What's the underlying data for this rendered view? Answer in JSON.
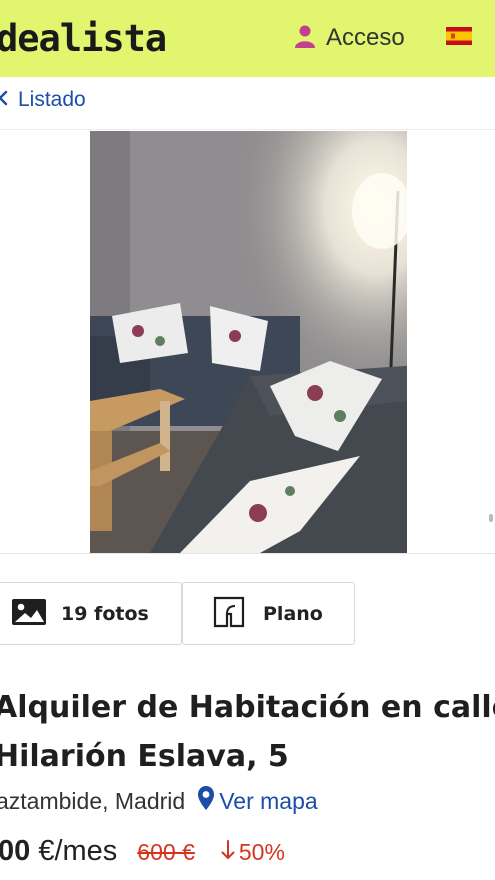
{
  "header": {
    "logo": "dealista",
    "access_label": "Acceso",
    "icons": {
      "user": "user-icon",
      "flag": "spain-flag-icon"
    },
    "colors": {
      "background": "#e1f56e",
      "user_icon": "#c2418f"
    }
  },
  "nav": {
    "back_label": "Listado",
    "icons": {
      "back": "chevron-left-icon"
    }
  },
  "gallery": {
    "photos_label": "19 fotos",
    "plan_label": "Plano",
    "icons": {
      "photos": "image-icon",
      "plan": "floor-plan-icon"
    }
  },
  "listing": {
    "title": "Alquiler de Habitación en calle\nHilarión Eslava, 5",
    "location": "aztambide, Madrid",
    "map_link": "Ver mapa",
    "price_number": "00",
    "price_unit": " €/mes",
    "old_price": "600 €",
    "discount": "50%",
    "icons": {
      "map": "location-pin-icon",
      "discount": "arrow-down-icon"
    },
    "colors": {
      "link": "#1b4ea8",
      "discount": "#d6341f"
    }
  }
}
